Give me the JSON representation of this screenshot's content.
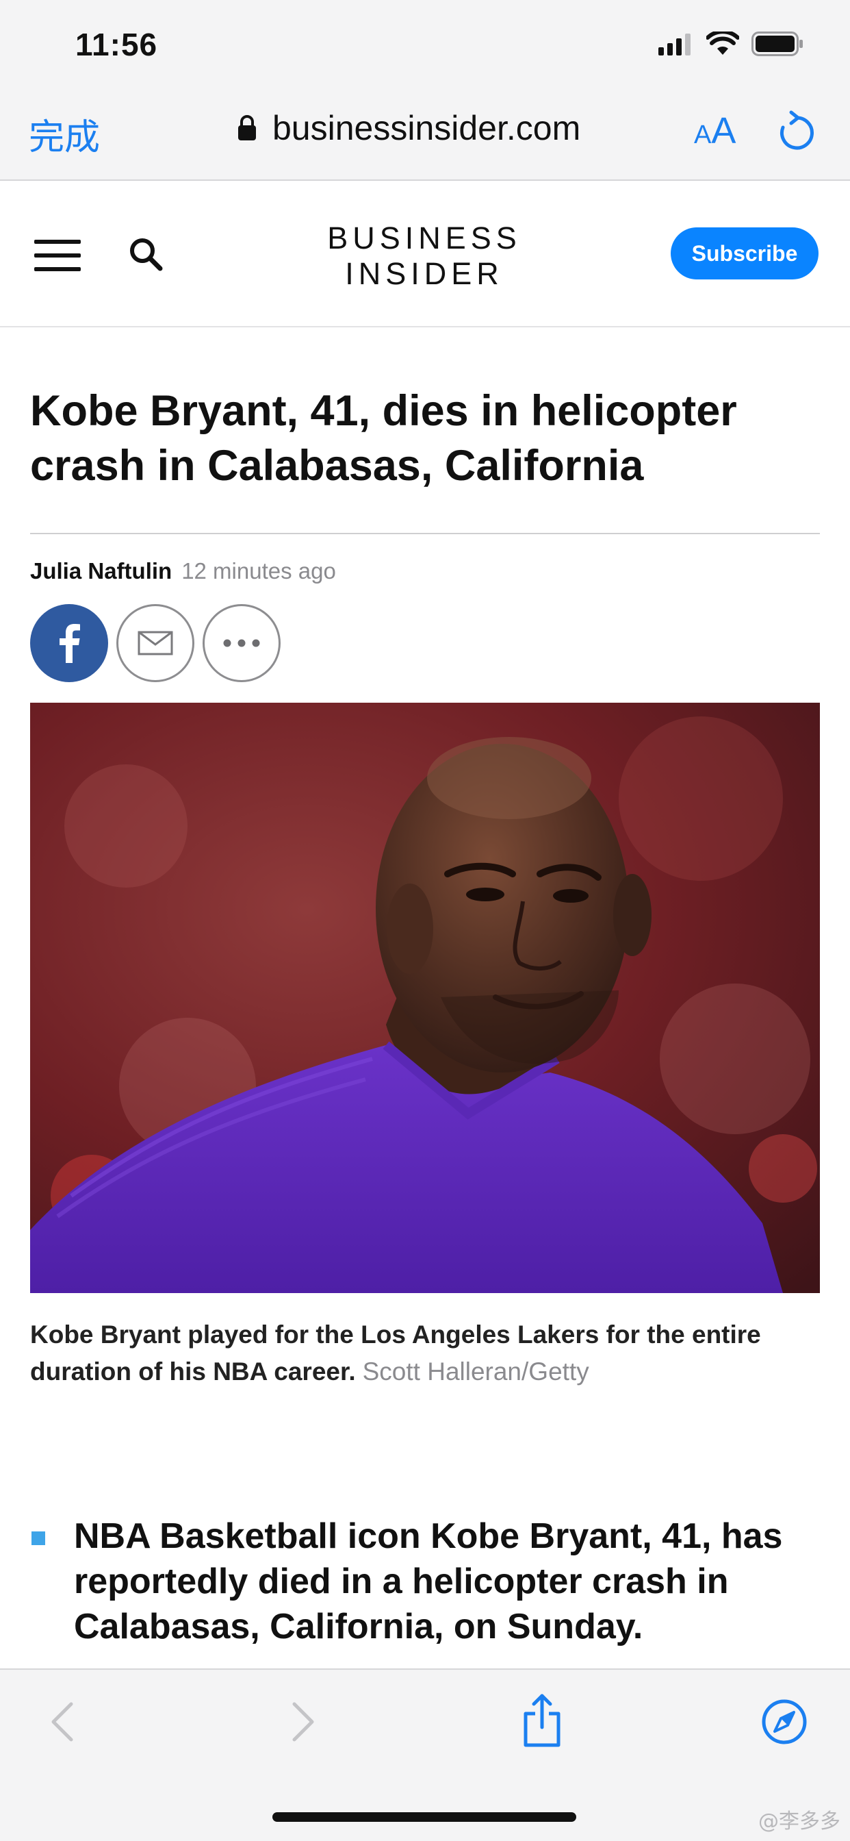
{
  "status_bar": {
    "time": "11:56"
  },
  "browser": {
    "done_label": "完成",
    "url": "businessinsider.com",
    "text_size_small": "A",
    "text_size_large": "A"
  },
  "site": {
    "logo_line1": "BUSINESS",
    "logo_line2": "INSIDER",
    "subscribe_label": "Subscribe"
  },
  "article": {
    "headline": "Kobe Bryant, 41, dies in helicopter crash in Calabasas, California",
    "author": "Julia Naftulin",
    "published": "12 minutes ago",
    "caption": "Kobe Bryant played for the Los Angeles Lakers for the entire duration of his NBA career.",
    "photo_credit": "Scott Halleran/Getty",
    "bullets": [
      "NBA Basketball icon Kobe Bryant, 41, has reportedly died in a helicopter crash in Calabasas, California, on Sunday."
    ]
  },
  "watermark": "@李多多",
  "colors": {
    "accent_blue": "#1b7ff0",
    "subscribe_blue": "#0a84ff",
    "facebook_blue": "#2f5aa0",
    "bullet_blue": "#3ea4e8"
  },
  "icons": [
    "signal-icon",
    "wifi-icon",
    "battery-icon",
    "lock-icon",
    "reload-icon",
    "menu-icon",
    "search-icon",
    "facebook-icon",
    "mail-icon",
    "more-icon",
    "back-icon",
    "forward-icon",
    "share-icon",
    "compass-icon"
  ]
}
